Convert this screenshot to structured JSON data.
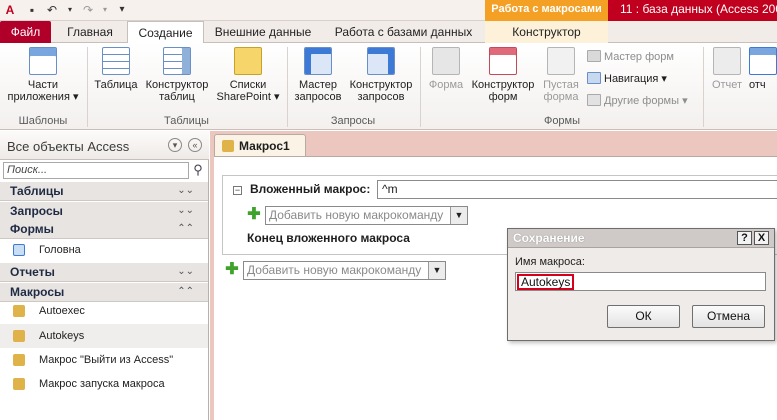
{
  "titlebar": {
    "qat_icons": [
      "save-icon",
      "undo-icon",
      "redo-icon",
      "customize-icon"
    ],
    "context_header": "Работа с макросами",
    "app_title": "11 : база данных (Access 2007"
  },
  "tabs": {
    "file": "Файл",
    "home": "Главная",
    "create": "Создание",
    "external": "Внешние данные",
    "database": "Работа с базами данных",
    "designer": "Конструктор"
  },
  "ribbon": {
    "templates_group": "Шаблоны",
    "tables_group": "Таблицы",
    "queries_group": "Запросы",
    "forms_group": "Формы",
    "app_parts_line1": "Части",
    "app_parts_line2": "приложения ▾",
    "table": "Таблица",
    "table_designer_line1": "Конструктор",
    "table_designer_line2": "таблиц",
    "sharepoint_line1": "Списки",
    "sharepoint_line2": "SharePoint ▾",
    "query_wizard_line1": "Мастер",
    "query_wizard_line2": "запросов",
    "query_designer_line1": "Конструктор",
    "query_designer_line2": "запросов",
    "form": "Форма",
    "form_designer_line1": "Конструктор",
    "form_designer_line2": "форм",
    "blank_form_line1": "Пустая",
    "blank_form_line2": "форма",
    "form_wizard": "Мастер форм",
    "navigation": "Навигация ▾",
    "other_forms": "Другие формы ▾",
    "report": "Отчет",
    "report_cut": "отч"
  },
  "nav": {
    "title": "Все объекты Access",
    "search_placeholder": "Поиск...",
    "groups": {
      "tables": "Таблицы",
      "queries": "Запросы",
      "forms": "Формы",
      "reports": "Отчеты",
      "macros": "Макросы"
    },
    "forms_items": [
      "Головна"
    ],
    "macro_items": [
      "Autoexec",
      "Autokeys",
      "Макрос \"Выйти из Access\"",
      "Макрос запуска макроса"
    ]
  },
  "document": {
    "tab_label": "Макрос1",
    "submacro_label": "Вложенный макрос:",
    "submacro_name": "^m",
    "add_action_placeholder": "Добавить новую макрокоманду",
    "end_submacro": "Конец вложенного макроса"
  },
  "dialog": {
    "title": "Сохранение",
    "help": "?",
    "close": "X",
    "label": "Имя макроса:",
    "value": "Autokeys",
    "ok": "ОК",
    "cancel": "Отмена"
  },
  "colors": {
    "file_tab": "#b0002a",
    "context_header": "#f4a024",
    "title_red": "#c0001e",
    "doc_background": "#ecc7c0",
    "highlight_border": "#d5001c"
  }
}
